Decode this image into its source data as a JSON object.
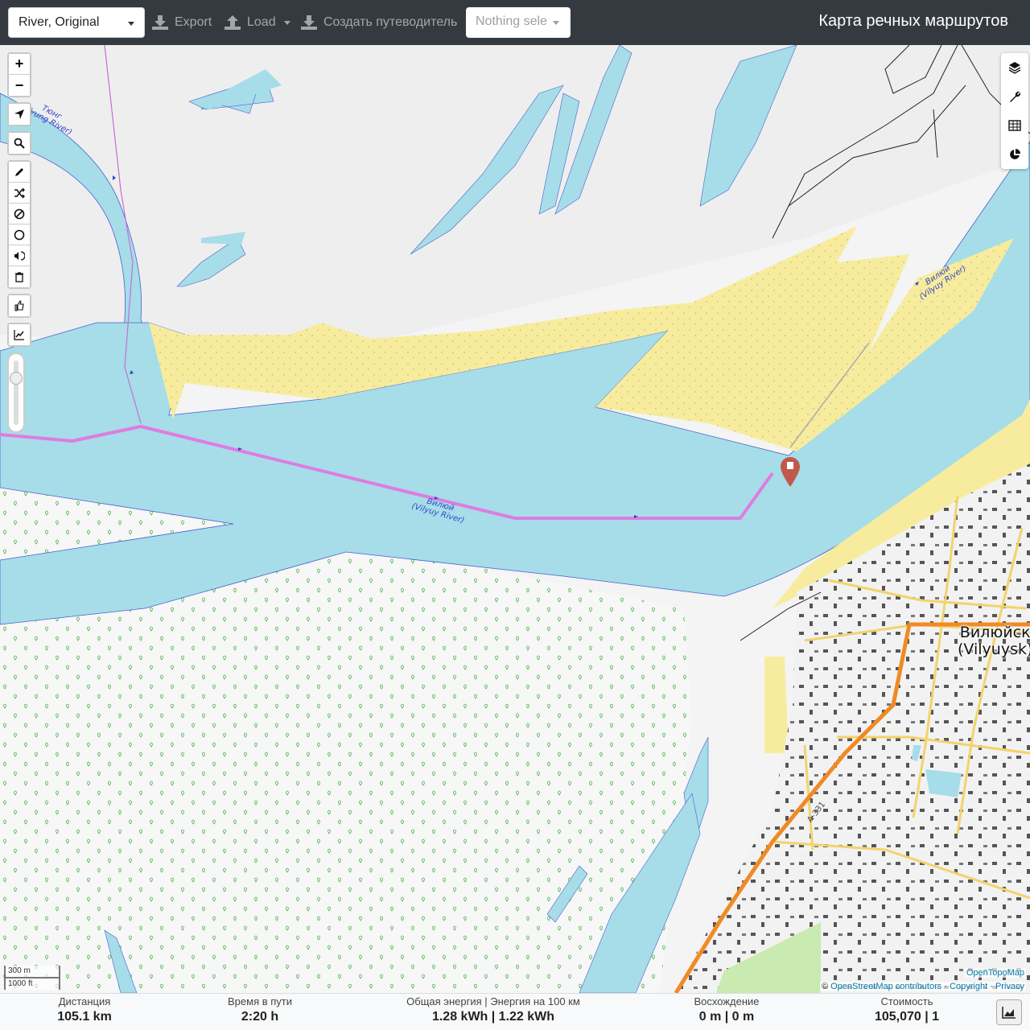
{
  "header": {
    "profile_label": "River, Original",
    "export_label": "Export",
    "load_label": "Load",
    "guide_label": "Создать путеводитель",
    "route_select_label": "Nothing sele",
    "brand_title": "Карта речных маршрутов"
  },
  "map": {
    "zoom_in_symbol": "+",
    "zoom_out_symbol": "−",
    "left_controls": [
      "locate-icon",
      "search-icon",
      "draw-pencil-icon",
      "shuffle-icon",
      "no-entry-icon",
      "circle-icon",
      "poi-sound-icon",
      "trash-icon",
      "thumbs-up-icon",
      "elevation-chart-icon"
    ],
    "right_controls": [
      "layers-icon",
      "wrench-icon",
      "table-icon",
      "pie-chart-icon"
    ],
    "labels": {
      "tyung_river": "Тюнг",
      "tyung_river_latin": "(Tyung River)",
      "vilyuy_river_main": "Вилюй",
      "vilyuy_river_main_latin": "(Vilyuy River)",
      "vilyuy_river_upper": "Вилюй",
      "vilyuy_river_upper_latin": "(Vilyuy River)",
      "city": "Вилюйск",
      "city_latin": "(Vilyuysk)",
      "road_shield": "А-331"
    },
    "scale": {
      "metric": "300 m",
      "imperial": "1000 ft"
    },
    "attribution": {
      "tiles": "OpenTopoMap",
      "prefix": "©",
      "osm": "OpenStreetMap contributors",
      "separator1": "·",
      "copyright": "Copyright",
      "separator2": "·",
      "privacy": "Privacy"
    },
    "colors": {
      "water": "#a6dde8",
      "sand": "#f7ec9e",
      "route": "#e07be0",
      "forest_symbol": "#4fb84f",
      "road_main": "#f08a24",
      "road_secondary": "#f3d36b",
      "marker": "#c1584c"
    }
  },
  "footer": {
    "distance_label": "Дистанция",
    "distance_value": "105.1 km",
    "time_label": "Время в пути",
    "time_value": "2:20 h",
    "energy_label": "Общая энергия | Энергия на 100 км",
    "energy_value": "1.28 kWh | 1.22 kWh",
    "ascent_label": "Восхождение",
    "ascent_value": "0 m | 0 m",
    "cost_label": "Стоимость",
    "cost_value": "105,070 | 1"
  }
}
